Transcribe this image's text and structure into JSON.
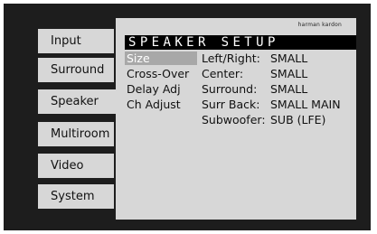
{
  "brand": "harman kardon",
  "sidebar": {
    "items": [
      {
        "label": "Input"
      },
      {
        "label": "Surround"
      },
      {
        "label": "Speaker"
      },
      {
        "label": "Multiroom"
      },
      {
        "label": "Video"
      },
      {
        "label": "System"
      }
    ],
    "active_label": "Speaker"
  },
  "panel": {
    "title": "SPEAKER SETUP",
    "menu": [
      {
        "label": "Size"
      },
      {
        "label": "Cross-Over"
      },
      {
        "label": "Delay Adj"
      },
      {
        "label": "Ch Adjust"
      }
    ],
    "selected_menu": "Size",
    "settings": [
      {
        "label": "Left/Right:",
        "value": "SMALL"
      },
      {
        "label": "Center:",
        "value": "SMALL"
      },
      {
        "label": "Surround:",
        "value": "SMALL"
      },
      {
        "label": "Surr Back:",
        "value": "SMALL MAIN"
      },
      {
        "label": "Subwoofer:",
        "value": "SUB (LFE)"
      }
    ]
  },
  "colors": {
    "screen_bg": "#1d1d1d",
    "panel_bg": "#d7d7d7",
    "title_bg": "#000000",
    "selected_bg": "#a8a8a8"
  }
}
